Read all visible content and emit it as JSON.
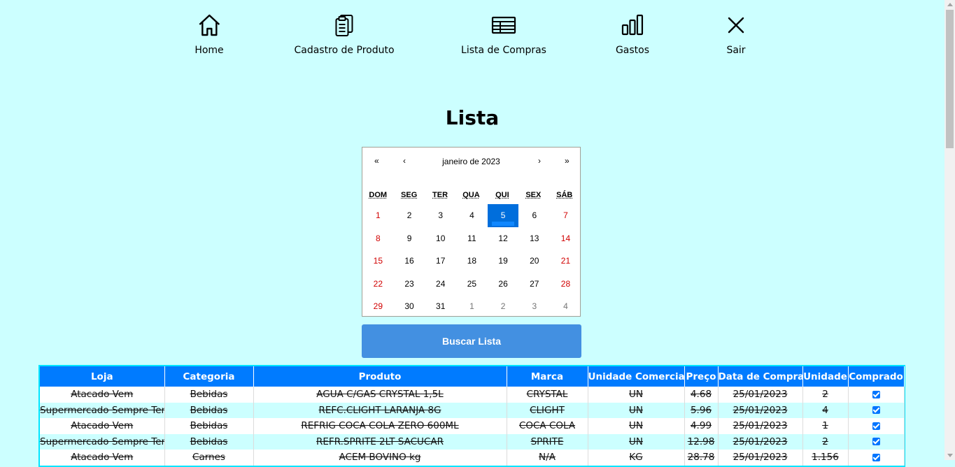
{
  "nav": [
    {
      "label": "Home",
      "icon": "home-icon"
    },
    {
      "label": "Cadastro de Produto",
      "icon": "clipboard-icon"
    },
    {
      "label": "Lista de Compras",
      "icon": "table-icon"
    },
    {
      "label": "Gastos",
      "icon": "bar-chart-icon"
    },
    {
      "label": "Sair",
      "icon": "close-icon"
    }
  ],
  "page": {
    "title": "Lista"
  },
  "calendar": {
    "prev2": "«",
    "prev": "‹",
    "label": "janeiro de 2023",
    "next": "›",
    "next2": "»",
    "weekdays": [
      "DOM",
      "SEG",
      "TER",
      "QUA",
      "QUI",
      "SEX",
      "SÁB"
    ],
    "selected_day": "5",
    "days": [
      "1",
      "2",
      "3",
      "4",
      "5",
      "6",
      "7",
      "8",
      "9",
      "10",
      "11",
      "12",
      "13",
      "14",
      "15",
      "16",
      "17",
      "18",
      "19",
      "20",
      "21",
      "22",
      "23",
      "24",
      "25",
      "26",
      "27",
      "28",
      "29",
      "30",
      "31",
      "1",
      "2",
      "3",
      "4"
    ]
  },
  "search_button": "Buscar Lista",
  "table": {
    "headers": [
      "Loja",
      "Categoria",
      "Produto",
      "Marca",
      "Unidade Comercial",
      "Preço",
      "Data de Compra",
      "Unidade",
      "Comprado"
    ],
    "rows": [
      [
        "Atacado Vem",
        "Bebidas",
        "AGUA C/GAS CRYSTAL 1,5L",
        "CRYSTAL",
        "UN",
        "4.68",
        "25/01/2023",
        "2"
      ],
      [
        "Supermercado Sempre Tem",
        "Bebidas",
        "REFC.CLIGHT LARANJA 8G",
        "CLIGHT",
        "UN",
        "5.96",
        "25/01/2023",
        "4"
      ],
      [
        "Atacado Vem",
        "Bebidas",
        "REFRIG COCA COLA ZERO 600ML",
        "COCA COLA",
        "UN",
        "4.99",
        "25/01/2023",
        "1"
      ],
      [
        "Supermercado Sempre Tem",
        "Bebidas",
        "REFR.SPRITE 2LT SACUCAR",
        "SPRITE",
        "UN",
        "12.98",
        "25/01/2023",
        "2"
      ],
      [
        "Atacado Vem",
        "Carnes",
        "ACEM BOVINO kg",
        "N/A",
        "KG",
        "28.78",
        "25/01/2023",
        "1.156"
      ]
    ],
    "comprado": [
      true,
      true,
      true,
      true,
      true
    ]
  }
}
